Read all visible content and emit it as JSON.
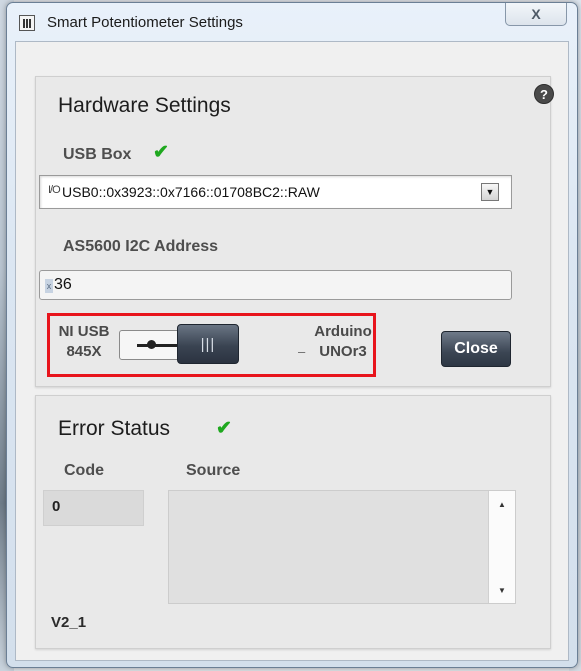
{
  "window": {
    "title": "Smart Potentiometer Settings",
    "close_symbol": "X"
  },
  "hardware": {
    "title": "Hardware Settings",
    "help_symbol": "?",
    "usb_box_label": "USB Box",
    "usb_box_status_icon": "check-icon",
    "io_tag": "I/O",
    "usb_box_value": "USB0::0x3923::0x7166::01708BC2::RAW",
    "address_label": "AS5600 I2C Address",
    "address_prefix": "x",
    "address_value": "36",
    "switch": {
      "left_label": "NI USB\n845X",
      "right_label": "Arduino\nUNOr3",
      "left_dash": "–",
      "right_dash": "–",
      "knob_glyph": "|||",
      "selected": "Arduino UNOr3"
    },
    "close_button": "Close"
  },
  "error": {
    "title": "Error Status",
    "status_icon": "check-icon",
    "code_label": "Code",
    "code_value": "0",
    "source_label": "Source",
    "source_value": ""
  },
  "version": "V2_1",
  "colors": {
    "check": "#1fa81f",
    "highlight": "#e8141c",
    "button_dark": "#3b4553"
  }
}
